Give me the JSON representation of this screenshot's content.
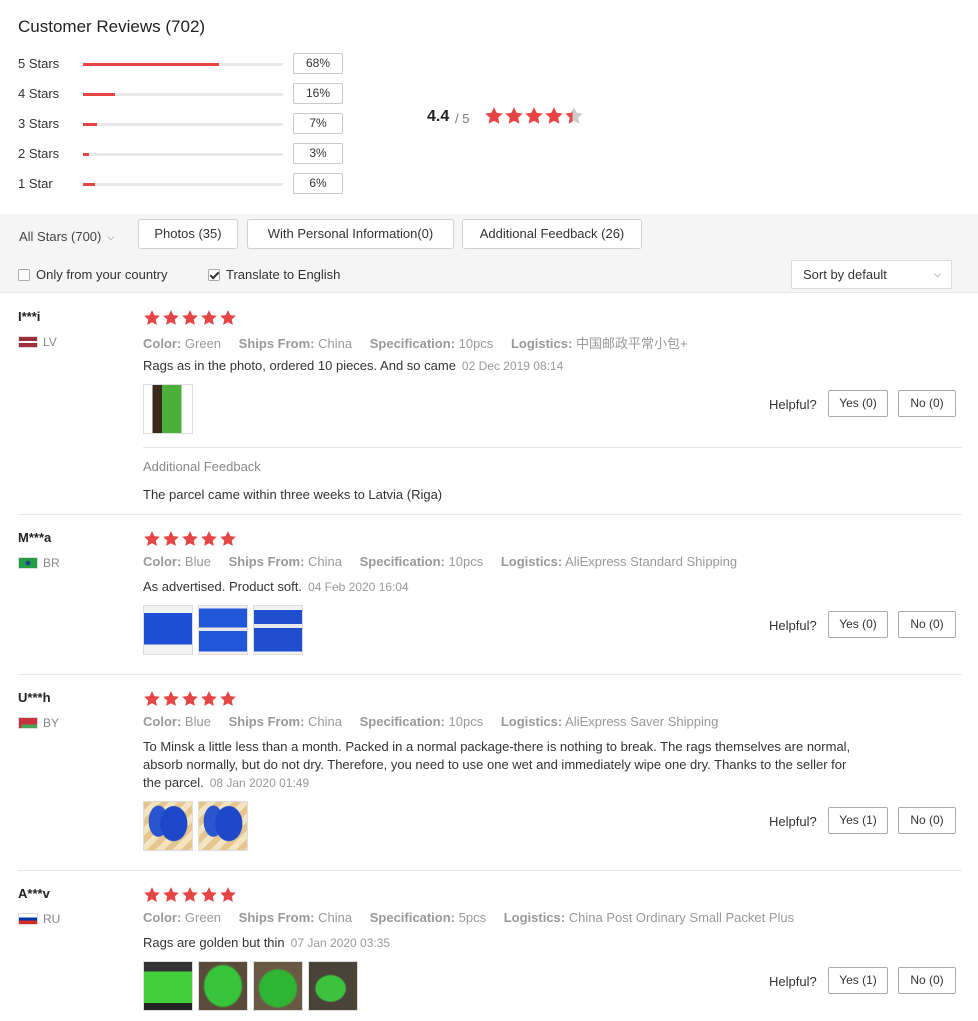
{
  "header": {
    "title": "Customer Reviews (702)",
    "distribution": [
      {
        "label": "5 Stars",
        "percent_label": "68%",
        "fraction": 0.68
      },
      {
        "label": "4 Stars",
        "percent_label": "16%",
        "fraction": 0.16
      },
      {
        "label": "3 Stars",
        "percent_label": "7%",
        "fraction": 0.07
      },
      {
        "label": "2 Stars",
        "percent_label": "3%",
        "fraction": 0.03
      },
      {
        "label": "1 Star",
        "percent_label": "6%",
        "fraction": 0.06
      }
    ],
    "average": "4.4",
    "out_of": "/ 5",
    "average_stars": 4.4
  },
  "filters": {
    "all_stars": "All Stars (700)",
    "photos": "Photos (35)",
    "personal_info": "With Personal Information(0)",
    "additional_feedback": "Additional Feedback (26)",
    "only_country": "Only from your country",
    "only_country_checked": false,
    "translate": "Translate to English",
    "translate_checked": true,
    "sort": "Sort by default"
  },
  "labels": {
    "color": "Color:",
    "ships_from": "Ships From:",
    "specification": "Specification:",
    "logistics": "Logistics:",
    "helpful": "Helpful?",
    "additional_feedback": "Additional Feedback"
  },
  "colors": {
    "star": "#e64545",
    "star_empty": "#cccccc",
    "bar": "#e64545"
  },
  "reviews": [
    {
      "user": "I***i",
      "country": "LV",
      "stars": 5,
      "color": "Green",
      "ships_from": "China",
      "specification": "10pcs",
      "logistics": "中国邮政平常小包+",
      "text": "Rags as in the photo, ordered 10 pieces. And so came",
      "date": "02 Dec 2019 08:14",
      "yes": "Yes (0)",
      "no": "No (0)",
      "additional_feedback": "The parcel came within three weeks to Latvia (Riga)"
    },
    {
      "user": "M***a",
      "country": "BR",
      "stars": 5,
      "color": "Blue",
      "ships_from": "China",
      "specification": "10pcs",
      "logistics": "AliExpress Standard Shipping",
      "text": "As advertised. Product soft.",
      "date": "04 Feb 2020 16:04",
      "yes": "Yes (0)",
      "no": "No (0)"
    },
    {
      "user": "U***h",
      "country": "BY",
      "stars": 5,
      "color": "Blue",
      "ships_from": "China",
      "specification": "10pcs",
      "logistics": "AliExpress Saver Shipping",
      "text": "To Minsk a little less than a month. Packed in a normal package-there is nothing to break. The rags themselves are normal, absorb normally, but do not dry. Therefore, you need to use one wet and immediately wipe one dry. Thanks to the seller for the parcel.",
      "date": "08 Jan 2020 01:49",
      "yes": "Yes (1)",
      "no": "No (0)"
    },
    {
      "user": "A***v",
      "country": "RU",
      "stars": 5,
      "color": "Green",
      "ships_from": "China",
      "specification": "5pcs",
      "logistics": "China Post Ordinary Small Packet Plus",
      "text": "Rags are golden but thin",
      "date": "07 Jan 2020 03:35",
      "yes": "Yes (1)",
      "no": "No (0)"
    }
  ]
}
